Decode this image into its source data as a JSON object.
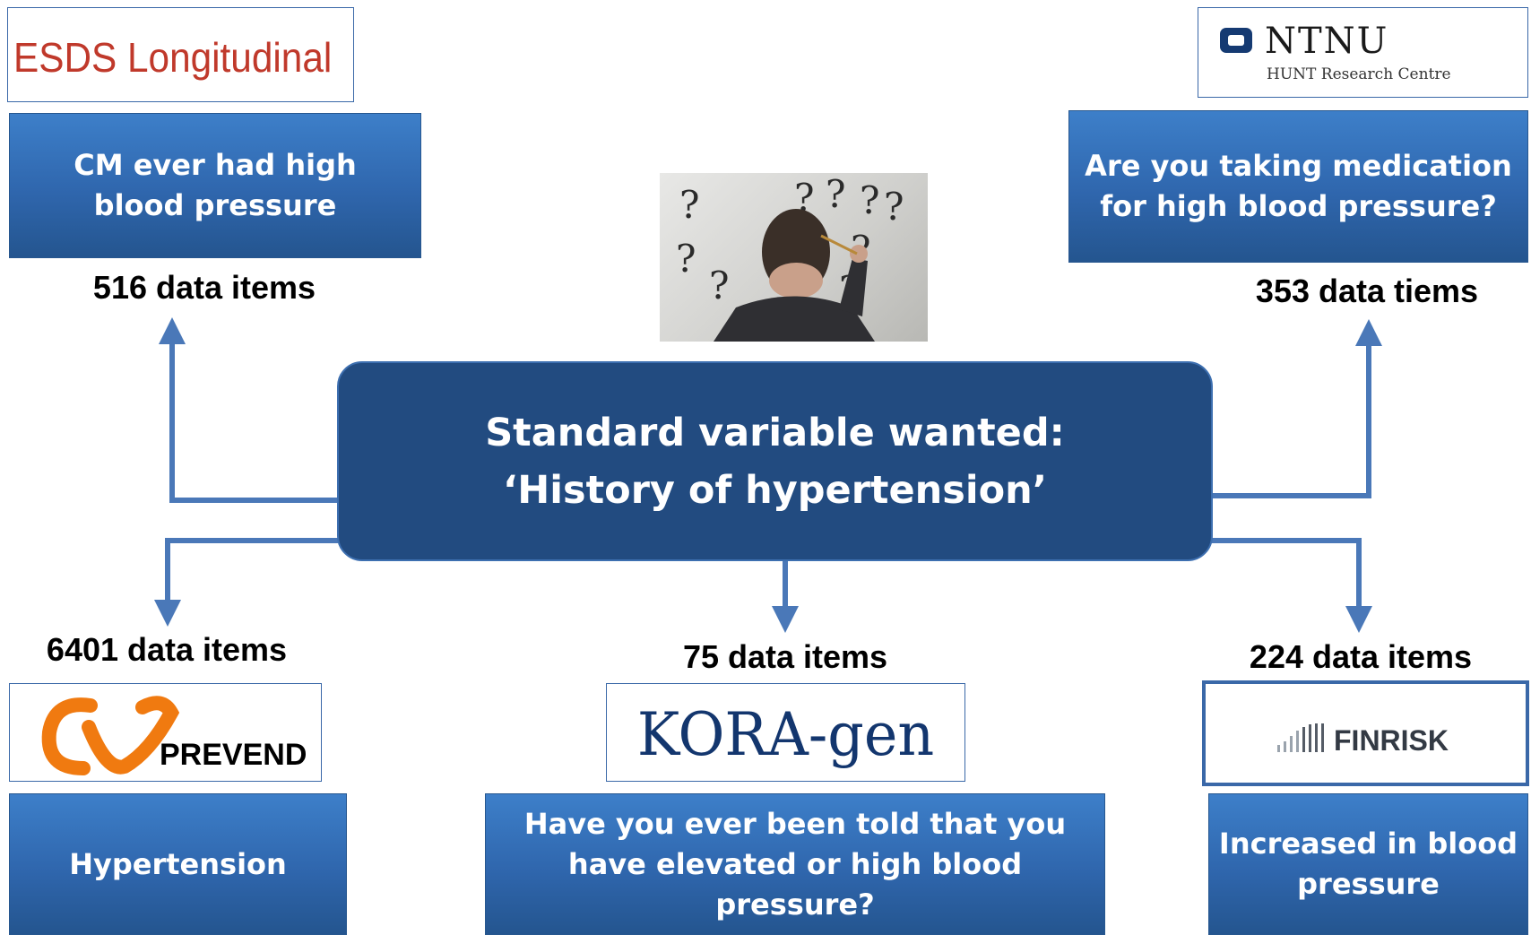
{
  "central": {
    "line1": "Standard variable wanted:",
    "line2": "‘History of hypertension’"
  },
  "sources": {
    "esds": {
      "logo_text": "ESDS Longitudinal",
      "question": "CM ever had high blood pressure",
      "count": "516 data items"
    },
    "ntnu": {
      "logo_text": "NTNU",
      "logo_subtext": "HUNT Research Centre",
      "question": "Are you taking medication for high blood pressure?",
      "count": "353 data tiems"
    },
    "prevend": {
      "logo_text": "PREVEND",
      "question": "Hypertension",
      "count": "6401 data items"
    },
    "kora": {
      "logo_text": "KORA-gen",
      "question": "Have you ever been told that you have elevated or high blood pressure?",
      "count": "75 data items"
    },
    "finrisk": {
      "logo_text": "FINRISK",
      "question": "Increased in blood pressure",
      "count": "224 data items"
    }
  },
  "colors": {
    "question_box": "#2f66ad",
    "central_box": "#224b80",
    "connector": "#4a78b8",
    "esds_logo": "#c0392b",
    "prevend_logo": "#f07a10",
    "kora_logo": "#13366e"
  },
  "image": {
    "icon": "thinking-man-question-marks-photo"
  }
}
